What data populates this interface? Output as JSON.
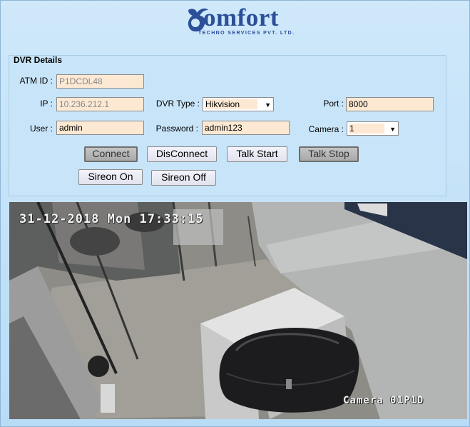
{
  "brand": {
    "name": "omfort",
    "tagline": "TECHNO SERVICES PVT. LTD.",
    "color": "#2b4f98"
  },
  "group": {
    "title": "DVR Details"
  },
  "fields": {
    "atm_id": {
      "label": "ATM ID :",
      "value": "P1DCDL48"
    },
    "ip": {
      "label": "IP :",
      "value": "10.236.212.1"
    },
    "dvr_type": {
      "label": "DVR Type :",
      "value": "Hikvision"
    },
    "port": {
      "label": "Port :",
      "value": "8000"
    },
    "user": {
      "label": "User :",
      "value": "admin"
    },
    "password": {
      "label": "Password :",
      "value": "admin123"
    },
    "camera": {
      "label": "Camera :",
      "value": "1"
    }
  },
  "buttons": {
    "connect": "Connect",
    "disconnect": "DisConnect",
    "talk_start": "Talk Start",
    "talk_stop": "Talk Stop",
    "sireon_on": "Sireon On",
    "sireon_off": "Sireon Off"
  },
  "video": {
    "timestamp": "31-12-2018 Mon 17:33:15",
    "camera_label": "Camera 01P1D"
  }
}
